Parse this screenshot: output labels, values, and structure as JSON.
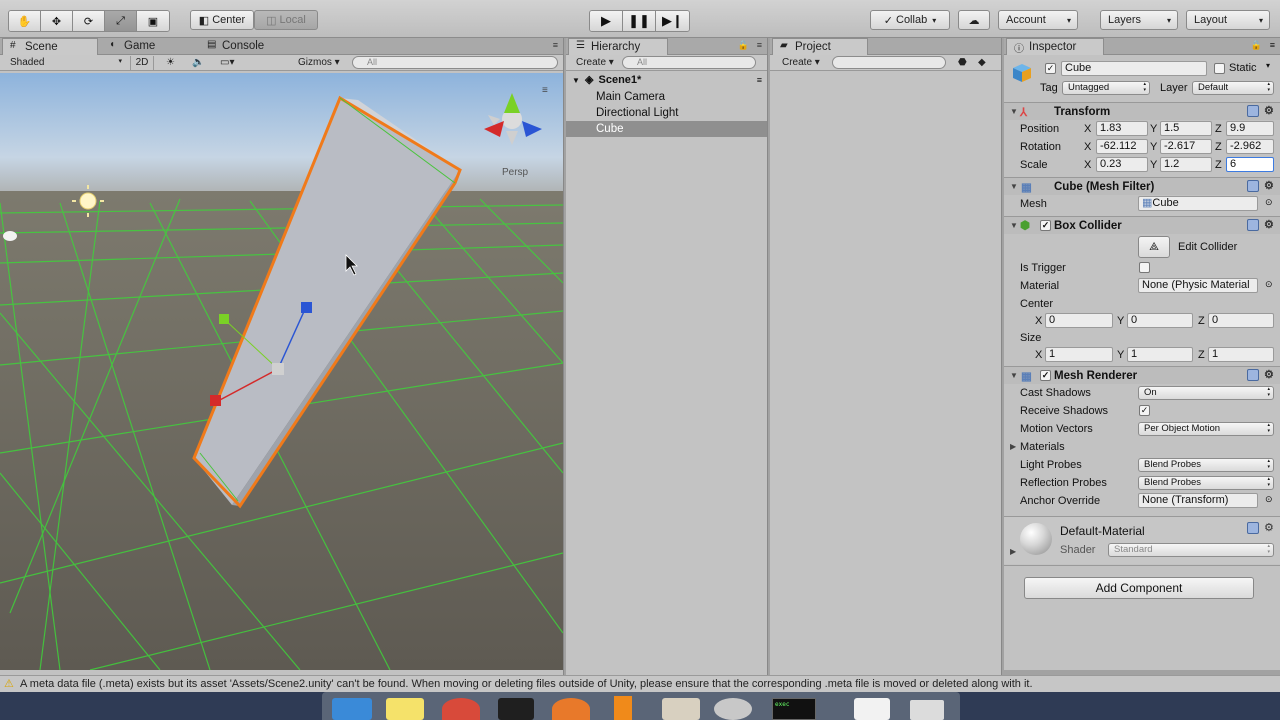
{
  "toolbar": {
    "tools": [
      "hand-tool",
      "move-tool",
      "rotate-tool",
      "scale-tool",
      "rect-tool"
    ],
    "pivot_label": "Center",
    "space_label": "Local",
    "collab_label": "Collab",
    "account_label": "Account",
    "layers_label": "Layers",
    "layout_label": "Layout"
  },
  "scene_panel": {
    "tabs": {
      "scene": "Scene",
      "game": "Game",
      "console": "Console"
    },
    "shading_mode": "Shaded",
    "mode_2d": "2D",
    "gizmos_label": "Gizmos",
    "search_placeholder": "All",
    "persp_label": "Persp"
  },
  "hierarchy": {
    "tab": "Hierarchy",
    "create_label": "Create",
    "search_placeholder": "All",
    "scene_name": "Scene1*",
    "items": [
      "Main Camera",
      "Directional Light",
      "Cube"
    ],
    "selected": "Cube"
  },
  "project": {
    "tab": "Project",
    "create_label": "Create"
  },
  "inspector": {
    "tab": "Inspector",
    "object_name": "Cube",
    "static_label": "Static",
    "tag_label": "Tag",
    "tag_value": "Untagged",
    "layer_label": "Layer",
    "layer_value": "Default",
    "transform": {
      "title": "Transform",
      "position_label": "Position",
      "rotation_label": "Rotation",
      "scale_label": "Scale",
      "position": {
        "x": "1.83",
        "y": "1.5",
        "z": "9.9"
      },
      "rotation": {
        "x": "-62.112",
        "y": "-2.617",
        "z": "-2.962"
      },
      "scale": {
        "x": "0.23",
        "y": "1.2",
        "z": "6"
      }
    },
    "mesh_filter": {
      "title": "Cube (Mesh Filter)",
      "mesh_label": "Mesh",
      "mesh_value": "Cube"
    },
    "box_collider": {
      "title": "Box Collider",
      "edit_label": "Edit Collider",
      "is_trigger_label": "Is Trigger",
      "material_label": "Material",
      "material_value": "None (Physic Material",
      "center_label": "Center",
      "center": {
        "x": "0",
        "y": "0",
        "z": "0"
      },
      "size_label": "Size",
      "size": {
        "x": "1",
        "y": "1",
        "z": "1"
      }
    },
    "mesh_renderer": {
      "title": "Mesh Renderer",
      "cast_shadows_label": "Cast Shadows",
      "cast_shadows_value": "On",
      "receive_shadows_label": "Receive Shadows",
      "motion_vectors_label": "Motion Vectors",
      "motion_vectors_value": "Per Object Motion",
      "materials_label": "Materials",
      "light_probes_label": "Light Probes",
      "light_probes_value": "Blend Probes",
      "reflection_probes_label": "Reflection Probes",
      "reflection_probes_value": "Blend Probes",
      "anchor_override_label": "Anchor Override",
      "anchor_override_value": "None (Transform)"
    },
    "material": {
      "name": "Default-Material",
      "shader_label": "Shader",
      "shader_value": "Standard"
    },
    "add_component_label": "Add Component",
    "axis": {
      "x": "X",
      "y": "Y",
      "z": "Z"
    }
  },
  "status": {
    "message": "A meta data file (.meta) exists but its asset 'Assets/Scene2.unity' can't be found. When moving or deleting files outside of Unity, please ensure that the corresponding .meta file is moved or deleted along with it."
  },
  "colors": {
    "selection_outline": "#f07a1a",
    "grid_line": "#3fd23a",
    "x_axis": "#d42a2a",
    "y_axis": "#7ad126",
    "z_axis": "#2a55d4"
  }
}
